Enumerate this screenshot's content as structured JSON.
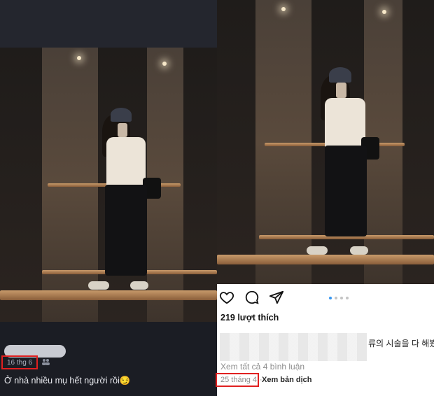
{
  "left_post": {
    "date": "16 thg 6",
    "caption": "Ở nhà nhiều mụ hết người rồi😏"
  },
  "right_post": {
    "likes": "219 lượt thích",
    "caption_fragment": "류의 시술을 다 해봤",
    "comments_link": "Xem tất cả 4 bình luận",
    "date": "25 tháng 4",
    "separator": "·",
    "translate": "Xem bản dịch",
    "carousel": {
      "count": 4,
      "active": 1
    },
    "icons": [
      "heart-icon",
      "comment-icon",
      "share-icon"
    ]
  },
  "colors": {
    "highlight": "#e02020",
    "carousel_active": "#3897f0"
  }
}
